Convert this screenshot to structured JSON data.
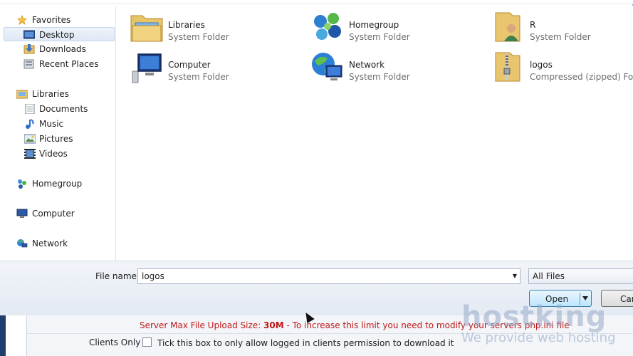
{
  "sidebar": {
    "favorites": {
      "label": "Favorites",
      "items": [
        {
          "label": "Desktop",
          "icon": "desktop-icon"
        },
        {
          "label": "Downloads",
          "icon": "downloads-icon"
        },
        {
          "label": "Recent Places",
          "icon": "recent-places-icon"
        }
      ]
    },
    "libraries": {
      "label": "Libraries",
      "items": [
        {
          "label": "Documents",
          "icon": "documents-icon"
        },
        {
          "label": "Music",
          "icon": "music-icon"
        },
        {
          "label": "Pictures",
          "icon": "pictures-icon"
        },
        {
          "label": "Videos",
          "icon": "videos-icon"
        }
      ]
    },
    "homegroup": {
      "label": "Homegroup"
    },
    "computer": {
      "label": "Computer"
    },
    "network": {
      "label": "Network"
    }
  },
  "content": {
    "items": [
      {
        "name": "Libraries",
        "type": "System Folder"
      },
      {
        "name": "Homegroup",
        "type": "System Folder"
      },
      {
        "name": "R",
        "type": "System Folder"
      },
      {
        "name": "Computer",
        "type": "System Folder"
      },
      {
        "name": "Network",
        "type": "System Folder"
      },
      {
        "name": "logos",
        "type": "Compressed (zipped) Folder"
      }
    ]
  },
  "footer": {
    "file_name_label": "File name:",
    "file_name_value": "logos",
    "filter_value": "All Files",
    "open_label": "Open",
    "cancel_label": "Cancel"
  },
  "page": {
    "warning_prefix": "Server Max File Upload Size: ",
    "warning_size": "30M",
    "warning_suffix": " - To increase this limit you need to modify your servers php.ini file",
    "clients_label": "Clients Only",
    "clients_text": "Tick this box to only allow logged in clients permission to download it"
  },
  "watermark": {
    "brand": "hostking",
    "tagline": "We provide web hosting"
  }
}
